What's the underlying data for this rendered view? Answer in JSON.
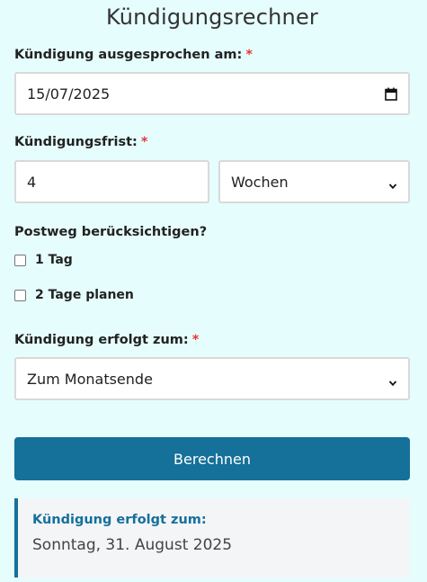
{
  "page": {
    "title": "Kündigungsrechner"
  },
  "form": {
    "date_label": "Kündigung ausgesprochen am:",
    "date_value": "15/07/2025",
    "period_label": "Kündigungsfrist:",
    "period_number": "4",
    "period_unit": "Wochen",
    "postal_label": "Postweg berücksichtigen?",
    "postal_options": [
      {
        "label": "1 Tag",
        "checked": false
      },
      {
        "label": "2 Tage planen",
        "checked": false
      }
    ],
    "effective_label": "Kündigung erfolgt zum:",
    "effective_value": "Zum Monatsende",
    "required_mark": "*"
  },
  "actions": {
    "calculate_label": "Berechnen"
  },
  "result": {
    "label": "Kündigung erfolgt zum:",
    "value": "Sonntag, 31. August 2025"
  },
  "colors": {
    "background": "#e6fdfd",
    "accent": "#15709a",
    "required": "#e53935"
  },
  "icons": {
    "date_icon": "calendar-icon",
    "select_icon": "chevron-down-icon"
  }
}
